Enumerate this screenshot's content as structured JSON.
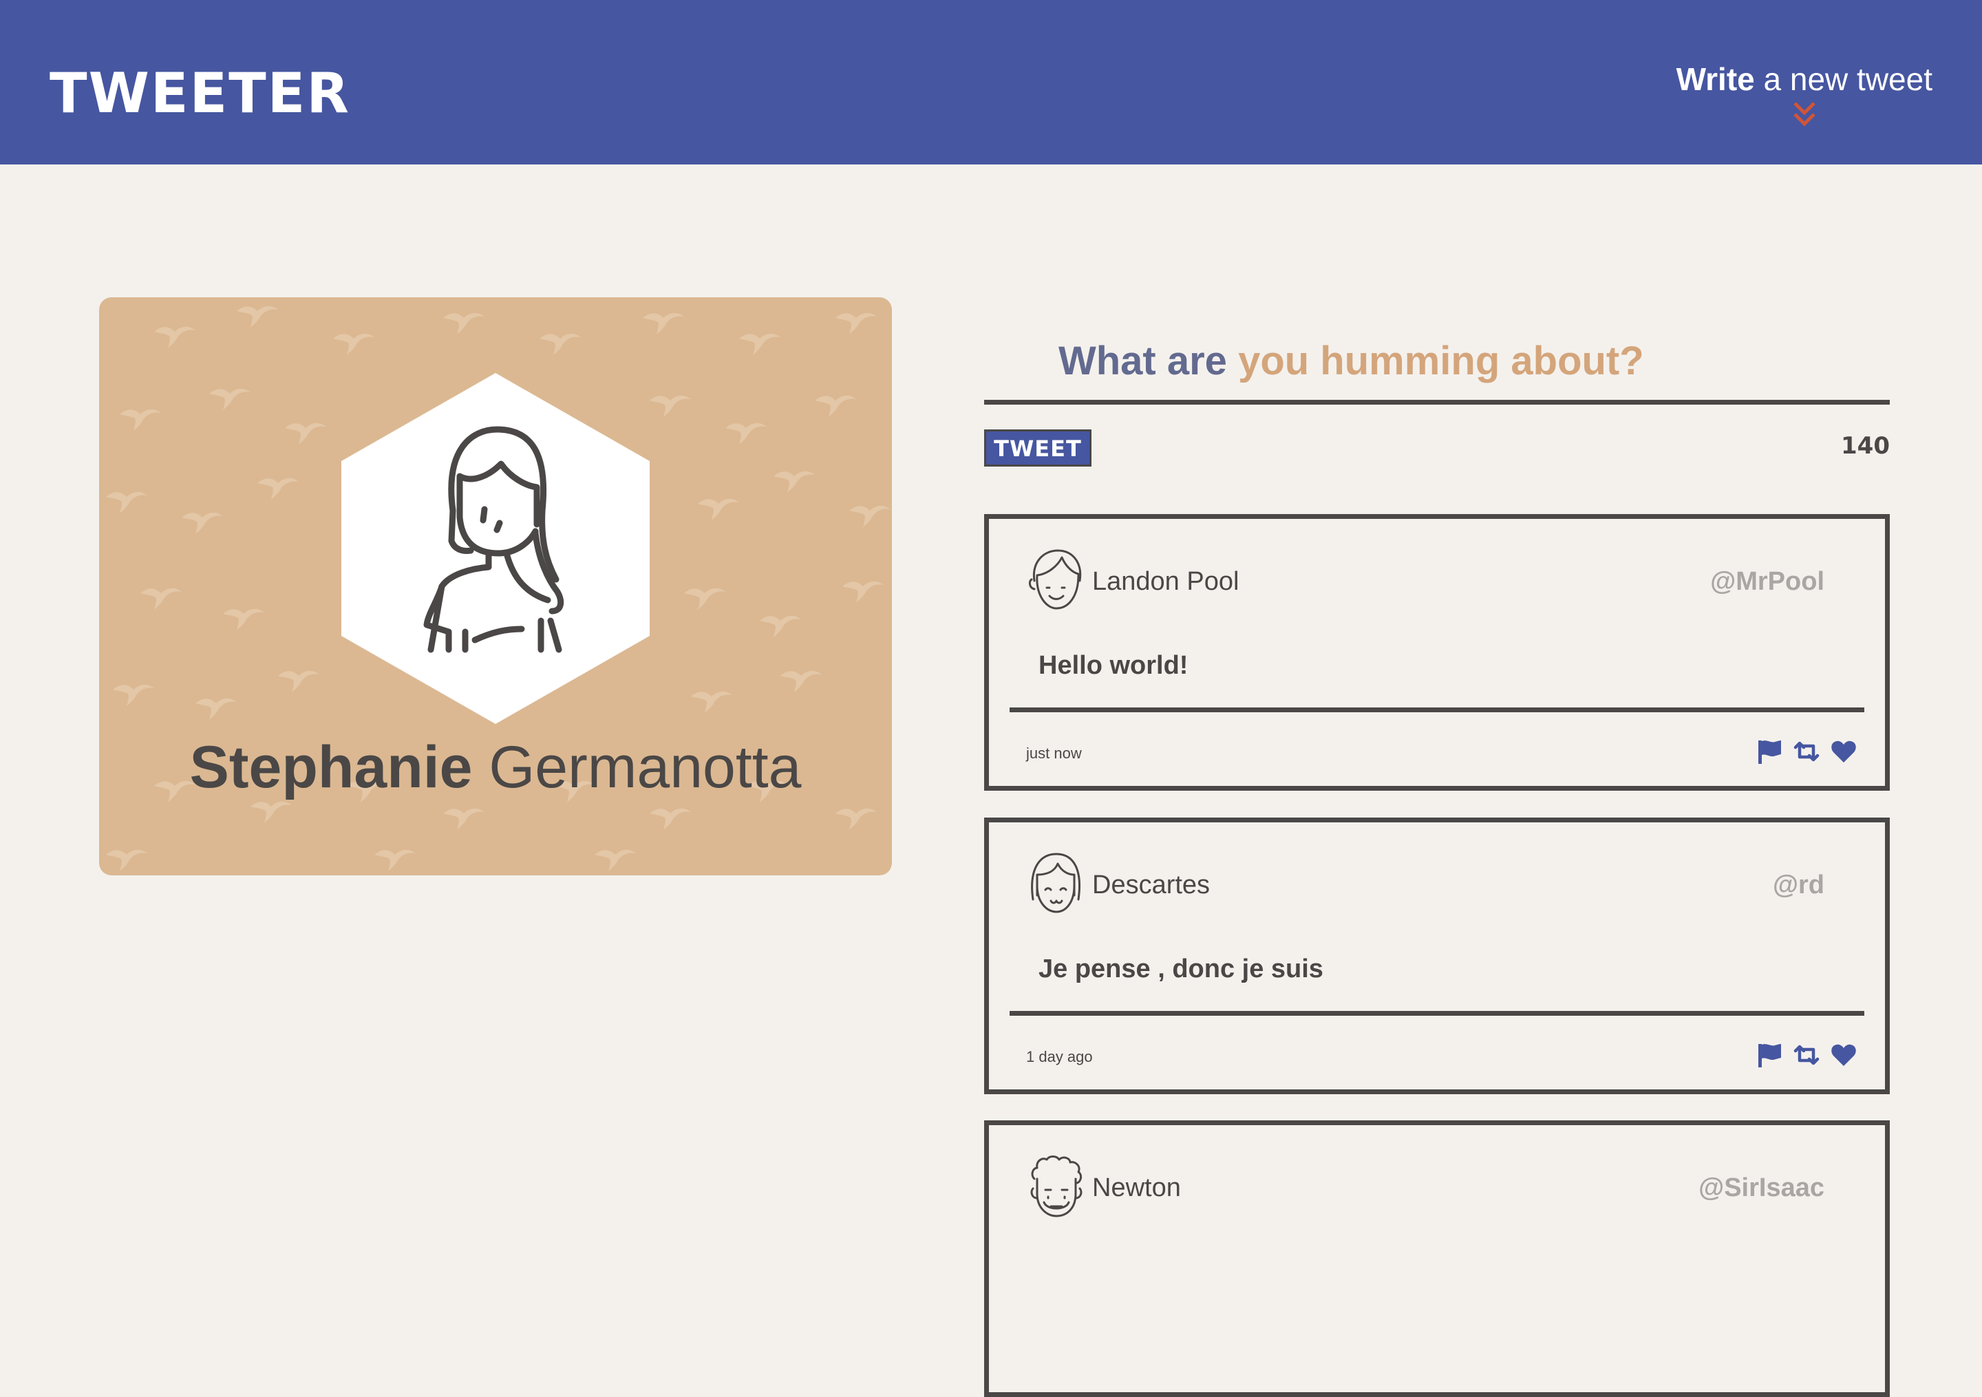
{
  "nav": {
    "logo": "TWEETER",
    "compose_bold": "Write",
    "compose_rest": " a new tweet",
    "compose_icon": "double-chevron-down-icon"
  },
  "profile": {
    "first_name": "Stephanie",
    "last_name": " Germanotta",
    "avatar_icon": "woman-avatar-icon"
  },
  "composer": {
    "prompt_part1": "What are",
    "prompt_part2": " you humming about?",
    "button_label": "TWEET",
    "counter": "140"
  },
  "tweets": [
    {
      "name": "Landon Pool",
      "handle": "@MrPool",
      "text": "Hello world!",
      "time": "just now",
      "avatar_icon": "boy-avatar-icon"
    },
    {
      "name": "Descartes",
      "handle": "@rd",
      "text": "Je pense , donc je suis",
      "time": "1 day ago",
      "avatar_icon": "girl-avatar-icon"
    },
    {
      "name": "Newton",
      "handle": "@SirIsaac",
      "text": "",
      "time": "",
      "avatar_icon": "curly-hair-avatar-icon"
    }
  ],
  "colors": {
    "nav": "#4656a0",
    "background": "#f4f1ed",
    "card": "#dbb892",
    "text": "#4a4746",
    "accent_orange": "#d4a57b",
    "chevron": "#d0553a"
  }
}
